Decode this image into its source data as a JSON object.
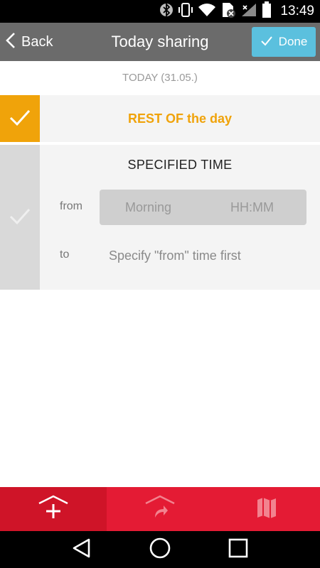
{
  "status_bar": {
    "time": "13:49",
    "icons": [
      "bluetooth-icon",
      "vibrate-icon",
      "wifi-icon",
      "no-sim-icon",
      "signal-icon",
      "battery-icon"
    ]
  },
  "app_bar": {
    "back_label": "Back",
    "title": "Today sharing",
    "done_label": "Done",
    "background": "#6b6b6b",
    "done_color": "#5bc0de"
  },
  "date_header": "TODAY (31.05.)",
  "rest_of_day": {
    "label": "REST OF the day",
    "selected": true,
    "accent": "#f0a30a"
  },
  "specified_time": {
    "title": "SPECIFIED TIME",
    "selected": false,
    "from_label": "from",
    "from_placeholder_part": "Morning",
    "from_placeholder_time": "HH:MM",
    "to_label": "to",
    "to_hint": "Specify \"from\" time first"
  },
  "tab_bar": {
    "background": "#e41b34",
    "tabs": [
      {
        "icon": "add-share-icon",
        "active": true
      },
      {
        "icon": "share-forward-icon",
        "active": false
      },
      {
        "icon": "map-icon",
        "active": false
      }
    ]
  },
  "nav_bar": {
    "buttons": [
      "back-triangle-icon",
      "home-circle-icon",
      "recents-square-icon"
    ]
  }
}
